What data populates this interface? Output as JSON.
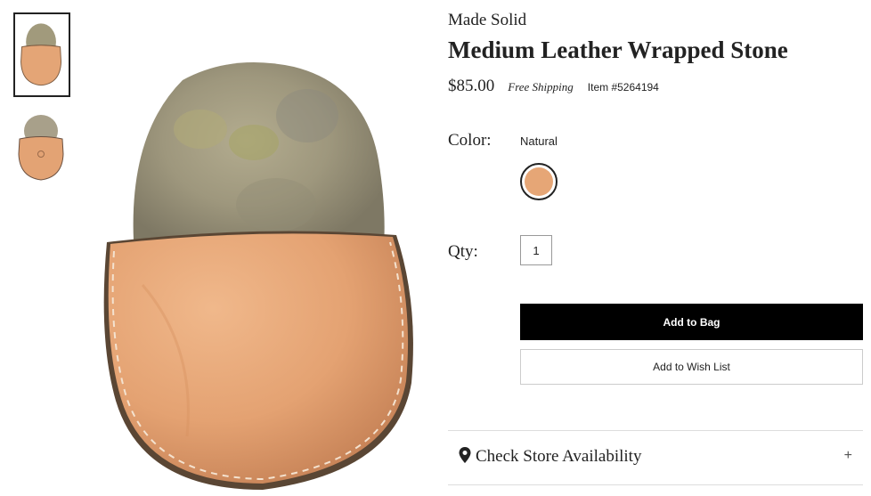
{
  "product": {
    "brand": "Made Solid",
    "title": "Medium Leather Wrapped Stone",
    "price": "$85.00",
    "shipping": "Free Shipping",
    "item_number": "Item #5264194"
  },
  "color": {
    "label": "Color:",
    "selected": "Natural",
    "swatch_color": "#e6a676"
  },
  "quantity": {
    "label": "Qty:",
    "value": "1"
  },
  "actions": {
    "add_to_bag": "Add to Bag",
    "add_to_wish_list": "Add to Wish List"
  },
  "store": {
    "label": "Check Store Availability",
    "expand_icon": "+"
  },
  "colors": {
    "leather": "#e6a676",
    "stone": "#a39a7a",
    "button_primary": "#000000"
  },
  "icons": {
    "store": "map-pin-icon",
    "expand": "plus-icon"
  }
}
